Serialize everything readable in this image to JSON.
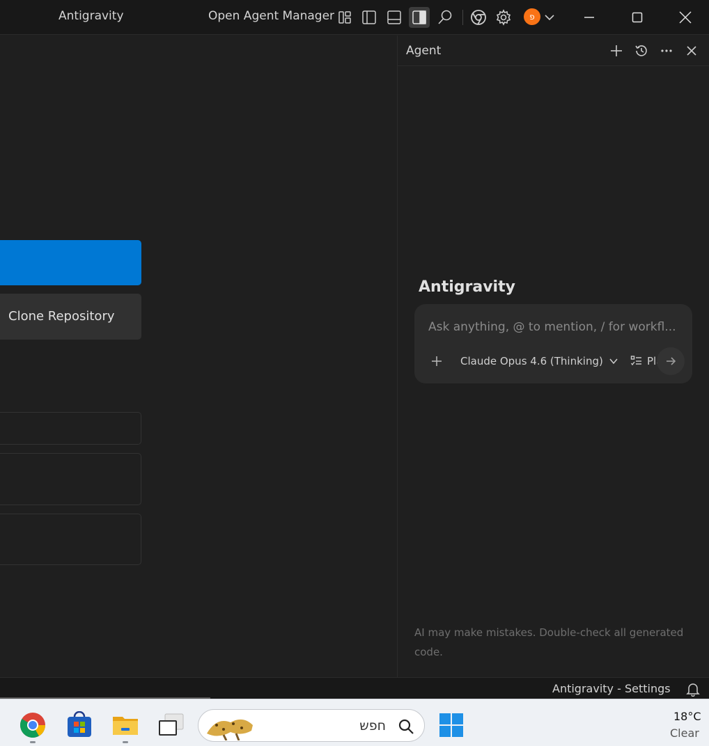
{
  "titlebar": {
    "app_title": "Antigravity",
    "agent_manager_label": "Open Agent Manager",
    "avatar_letter": "פ",
    "icons": [
      "layout-customize-icon",
      "toggle-primary-sidebar-icon",
      "toggle-panel-icon",
      "toggle-secondary-sidebar-icon",
      "search-icon",
      "chrome-icon",
      "gear-icon",
      "chevron-down-icon"
    ],
    "window_controls": [
      "minimize-icon",
      "maximize-icon",
      "close-icon"
    ]
  },
  "editor": {
    "clone_button_label": "Clone Repository"
  },
  "agent_panel": {
    "title": "Agent",
    "header_icons": [
      "plus-icon",
      "history-icon",
      "more-icon",
      "close-icon"
    ],
    "heading": "Antigravity",
    "input_placeholder": "Ask anything, @ to mention, / for workfl...",
    "model_label": "Claude Opus 4.6 (Thinking)",
    "plan_label": "Plan",
    "disclaimer": "AI may make mistakes. Double-check all generated code."
  },
  "statusbar": {
    "settings_label": "Antigravity - Settings"
  },
  "taskbar": {
    "search_text": "חפש",
    "weather_temp": "18°C",
    "weather_condition": "Clear",
    "apps": [
      "chrome-icon",
      "microsoft-store-icon",
      "file-explorer-icon",
      "task-view-icon",
      "windows-icon"
    ]
  },
  "colors": {
    "accent": "#0078d4",
    "avatar": "#f97316",
    "background": "#1f1f1f",
    "titlebar": "#181818"
  }
}
